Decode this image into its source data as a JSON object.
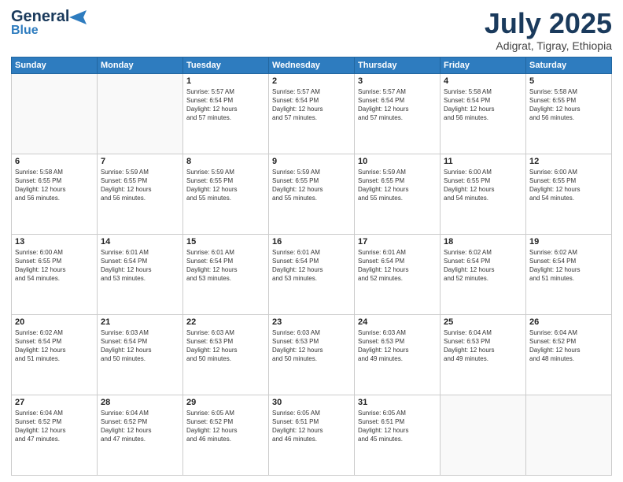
{
  "logo": {
    "line1": "General",
    "line2": "Blue"
  },
  "title": "July 2025",
  "subtitle": "Adigrat, Tigray, Ethiopia",
  "weekdays": [
    "Sunday",
    "Monday",
    "Tuesday",
    "Wednesday",
    "Thursday",
    "Friday",
    "Saturday"
  ],
  "weeks": [
    [
      {
        "day": "",
        "info": ""
      },
      {
        "day": "",
        "info": ""
      },
      {
        "day": "1",
        "info": "Sunrise: 5:57 AM\nSunset: 6:54 PM\nDaylight: 12 hours\nand 57 minutes."
      },
      {
        "day": "2",
        "info": "Sunrise: 5:57 AM\nSunset: 6:54 PM\nDaylight: 12 hours\nand 57 minutes."
      },
      {
        "day": "3",
        "info": "Sunrise: 5:57 AM\nSunset: 6:54 PM\nDaylight: 12 hours\nand 57 minutes."
      },
      {
        "day": "4",
        "info": "Sunrise: 5:58 AM\nSunset: 6:54 PM\nDaylight: 12 hours\nand 56 minutes."
      },
      {
        "day": "5",
        "info": "Sunrise: 5:58 AM\nSunset: 6:55 PM\nDaylight: 12 hours\nand 56 minutes."
      }
    ],
    [
      {
        "day": "6",
        "info": "Sunrise: 5:58 AM\nSunset: 6:55 PM\nDaylight: 12 hours\nand 56 minutes."
      },
      {
        "day": "7",
        "info": "Sunrise: 5:59 AM\nSunset: 6:55 PM\nDaylight: 12 hours\nand 56 minutes."
      },
      {
        "day": "8",
        "info": "Sunrise: 5:59 AM\nSunset: 6:55 PM\nDaylight: 12 hours\nand 55 minutes."
      },
      {
        "day": "9",
        "info": "Sunrise: 5:59 AM\nSunset: 6:55 PM\nDaylight: 12 hours\nand 55 minutes."
      },
      {
        "day": "10",
        "info": "Sunrise: 5:59 AM\nSunset: 6:55 PM\nDaylight: 12 hours\nand 55 minutes."
      },
      {
        "day": "11",
        "info": "Sunrise: 6:00 AM\nSunset: 6:55 PM\nDaylight: 12 hours\nand 54 minutes."
      },
      {
        "day": "12",
        "info": "Sunrise: 6:00 AM\nSunset: 6:55 PM\nDaylight: 12 hours\nand 54 minutes."
      }
    ],
    [
      {
        "day": "13",
        "info": "Sunrise: 6:00 AM\nSunset: 6:55 PM\nDaylight: 12 hours\nand 54 minutes."
      },
      {
        "day": "14",
        "info": "Sunrise: 6:01 AM\nSunset: 6:54 PM\nDaylight: 12 hours\nand 53 minutes."
      },
      {
        "day": "15",
        "info": "Sunrise: 6:01 AM\nSunset: 6:54 PM\nDaylight: 12 hours\nand 53 minutes."
      },
      {
        "day": "16",
        "info": "Sunrise: 6:01 AM\nSunset: 6:54 PM\nDaylight: 12 hours\nand 53 minutes."
      },
      {
        "day": "17",
        "info": "Sunrise: 6:01 AM\nSunset: 6:54 PM\nDaylight: 12 hours\nand 52 minutes."
      },
      {
        "day": "18",
        "info": "Sunrise: 6:02 AM\nSunset: 6:54 PM\nDaylight: 12 hours\nand 52 minutes."
      },
      {
        "day": "19",
        "info": "Sunrise: 6:02 AM\nSunset: 6:54 PM\nDaylight: 12 hours\nand 51 minutes."
      }
    ],
    [
      {
        "day": "20",
        "info": "Sunrise: 6:02 AM\nSunset: 6:54 PM\nDaylight: 12 hours\nand 51 minutes."
      },
      {
        "day": "21",
        "info": "Sunrise: 6:03 AM\nSunset: 6:54 PM\nDaylight: 12 hours\nand 50 minutes."
      },
      {
        "day": "22",
        "info": "Sunrise: 6:03 AM\nSunset: 6:53 PM\nDaylight: 12 hours\nand 50 minutes."
      },
      {
        "day": "23",
        "info": "Sunrise: 6:03 AM\nSunset: 6:53 PM\nDaylight: 12 hours\nand 50 minutes."
      },
      {
        "day": "24",
        "info": "Sunrise: 6:03 AM\nSunset: 6:53 PM\nDaylight: 12 hours\nand 49 minutes."
      },
      {
        "day": "25",
        "info": "Sunrise: 6:04 AM\nSunset: 6:53 PM\nDaylight: 12 hours\nand 49 minutes."
      },
      {
        "day": "26",
        "info": "Sunrise: 6:04 AM\nSunset: 6:52 PM\nDaylight: 12 hours\nand 48 minutes."
      }
    ],
    [
      {
        "day": "27",
        "info": "Sunrise: 6:04 AM\nSunset: 6:52 PM\nDaylight: 12 hours\nand 47 minutes."
      },
      {
        "day": "28",
        "info": "Sunrise: 6:04 AM\nSunset: 6:52 PM\nDaylight: 12 hours\nand 47 minutes."
      },
      {
        "day": "29",
        "info": "Sunrise: 6:05 AM\nSunset: 6:52 PM\nDaylight: 12 hours\nand 46 minutes."
      },
      {
        "day": "30",
        "info": "Sunrise: 6:05 AM\nSunset: 6:51 PM\nDaylight: 12 hours\nand 46 minutes."
      },
      {
        "day": "31",
        "info": "Sunrise: 6:05 AM\nSunset: 6:51 PM\nDaylight: 12 hours\nand 45 minutes."
      },
      {
        "day": "",
        "info": ""
      },
      {
        "day": "",
        "info": ""
      }
    ]
  ]
}
